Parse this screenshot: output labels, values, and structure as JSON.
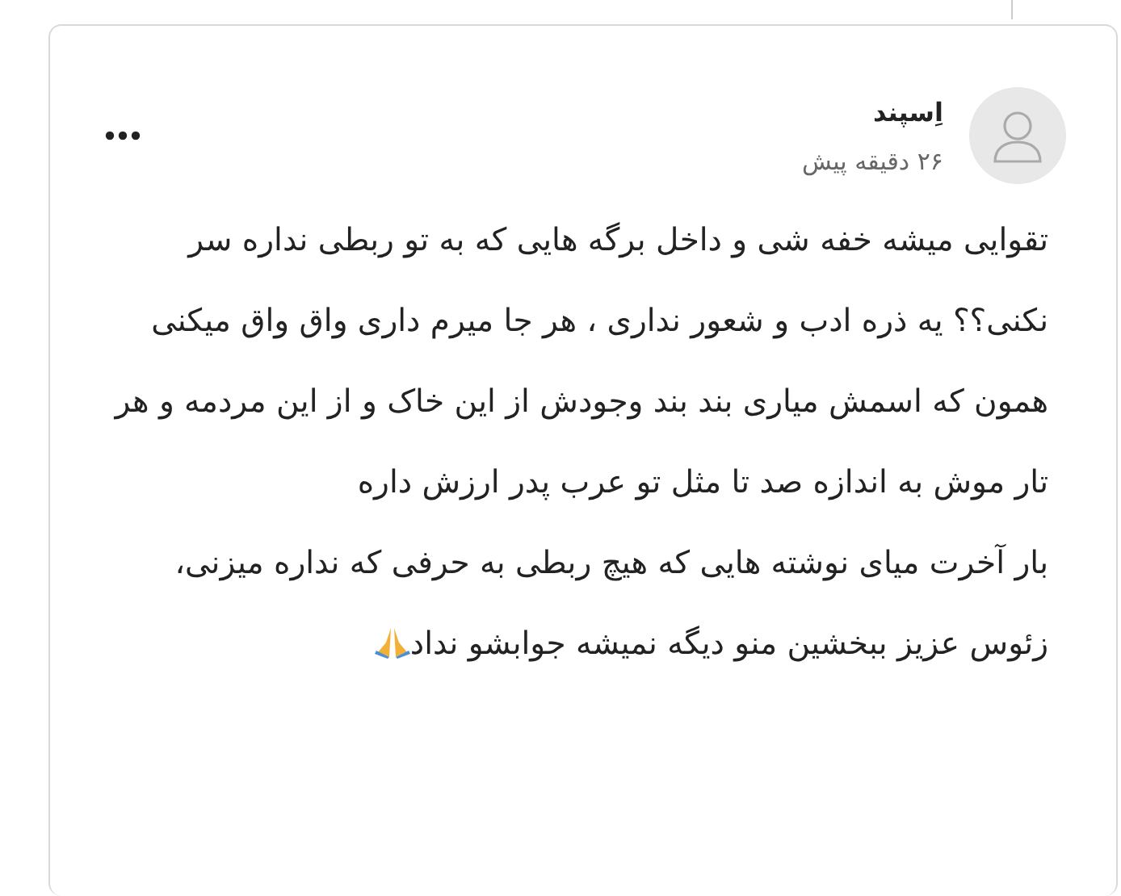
{
  "comment": {
    "author": "اِسپند",
    "time": "۲۶ دقیقه پیش",
    "paragraphs": [
      "تقوایی میشه خفه شی و داخل برگه هایی که به تو ربطی نداره سر نکنی؟؟ یه ذره ادب و شعور نداری ، هر جا میرم داری واق واق میکنی همون که اسمش میاری بند بند وجودش از این خاک و از این مردمه و هر تار موش به اندازه صد تا مثل تو عرب پدر ارزش داره",
      "بار آخرت میای نوشته هایی که هیچ ربطی به حرفی که نداره میزنی،",
      "زئوس عزیز ببخشین منو دیگه نمیشه جوابشو نداد"
    ]
  }
}
